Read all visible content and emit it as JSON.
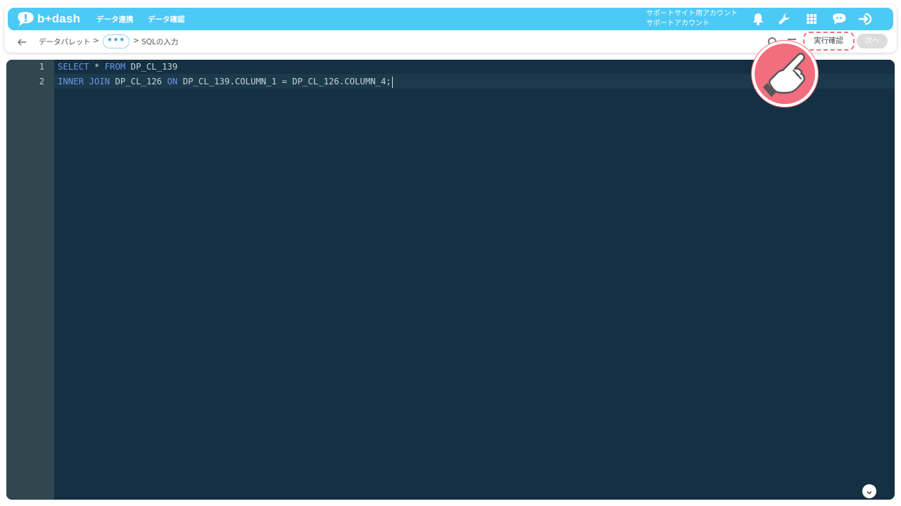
{
  "app": {
    "logo_text": "b+dash"
  },
  "nav": [
    {
      "label": "データ連携"
    },
    {
      "label": "データ確認"
    }
  ],
  "account": {
    "line1": "サポートサイト用アカウント",
    "line2": "サポートアカウント"
  },
  "header_icons": [
    "bell-icon",
    "wrench-icon",
    "grid-icon",
    "chat-bot-icon",
    "logout-icon"
  ],
  "breadcrumb": {
    "root": "データパレット",
    "sep1": ">",
    "ellipsis": "•••",
    "sep2": ">",
    "current": "SQLの入力"
  },
  "actions": {
    "exec_label": "実行確認",
    "next_label": "次へ"
  },
  "editor": {
    "line_numbers": [
      "1",
      "2"
    ],
    "lines": [
      [
        {
          "t": "SELECT",
          "kw": true
        },
        {
          "t": " * ",
          "kw": false
        },
        {
          "t": "FROM",
          "kw": true
        },
        {
          "t": " DP_CL_139",
          "kw": false
        }
      ],
      [
        {
          "t": "INNER JOIN",
          "kw": true
        },
        {
          "t": " DP_CL_126 ",
          "kw": false
        },
        {
          "t": "ON",
          "kw": true
        },
        {
          "t": " DP_CL_139.COLUMN_1 = DP_CL_126.COLUMN_4;",
          "kw": false
        }
      ]
    ]
  },
  "colors": {
    "topbar": "#4dc9f6",
    "editor_bg": "#143042",
    "gutter_bg": "#30474f",
    "keyword": "#6f93e6",
    "highlight": "#f26d7d"
  }
}
